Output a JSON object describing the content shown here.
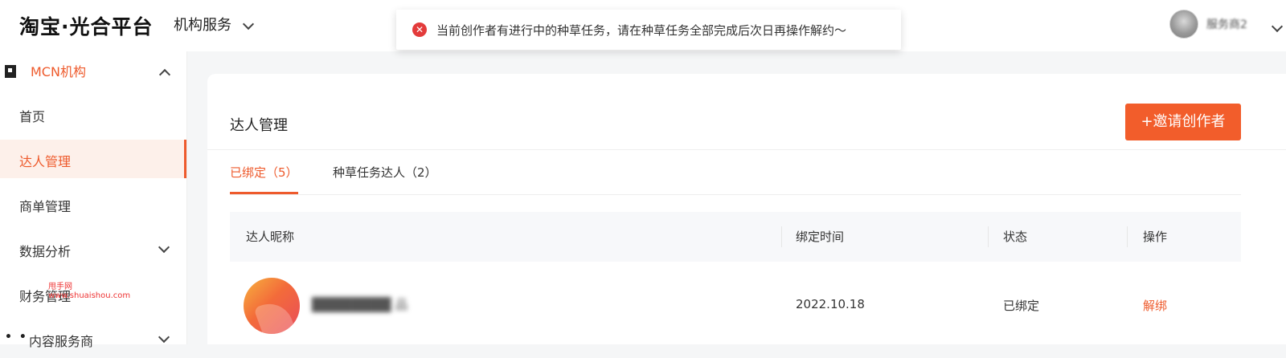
{
  "header": {
    "logo": "淘宝·光合平台",
    "service_nav": "机构服务",
    "user_name": "服务商2"
  },
  "toast": {
    "type": "error",
    "message": "当前创作者有进行中的种草任务，请在种草任务全部完成后次日再操作解约～"
  },
  "sidebar": {
    "group_label": "MCN机构",
    "items": [
      {
        "label": "首页"
      },
      {
        "label": "达人管理"
      },
      {
        "label": "商单管理"
      },
      {
        "label": "数据分析"
      },
      {
        "label": "财务管理"
      },
      {
        "label": "内容服务商"
      }
    ],
    "watermark_top": "甩手网",
    "watermark_url": "www.shuaishou.com"
  },
  "main": {
    "title": "达人管理",
    "invite_button": "+邀请创作者",
    "tabs": [
      {
        "label": "已绑定（5）"
      },
      {
        "label": "种草任务达人（2）"
      }
    ],
    "table": {
      "columns": [
        "达人昵称",
        "绑定时间",
        "状态",
        "操作"
      ],
      "rows": [
        {
          "nickname": "████████ 品",
          "bind_time": "2022.10.18",
          "status": "已绑定",
          "action": "解绑"
        }
      ]
    }
  },
  "colors": {
    "accent": "#ee5a2c",
    "error": "#e33b3b"
  }
}
